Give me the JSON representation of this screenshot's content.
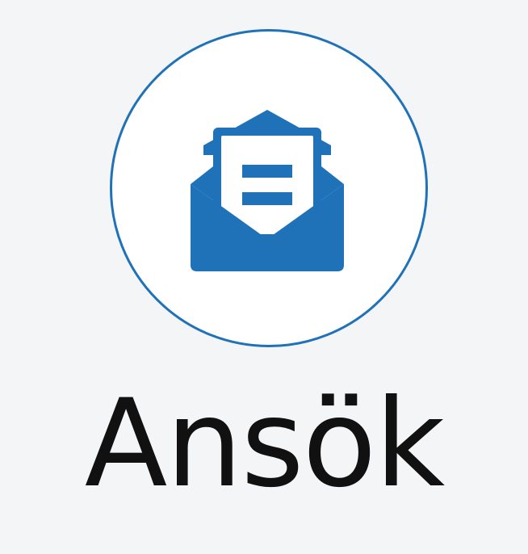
{
  "button": {
    "label": "Ansök",
    "icon": "envelope-open-icon"
  },
  "colors": {
    "accent": "#1f72b8",
    "background": "#f4f5f7",
    "circle_fill": "#ffffff",
    "text": "#111111"
  }
}
